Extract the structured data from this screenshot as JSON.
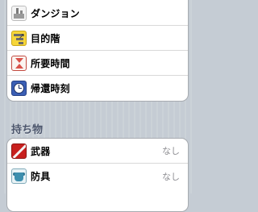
{
  "status": {
    "rows": [
      {
        "label": "ダンジョン",
        "icon": "dungeon-icon"
      },
      {
        "label": "目的階",
        "icon": "stairs-icon"
      },
      {
        "label": "所要時間",
        "icon": "hourglass-icon"
      },
      {
        "label": "帰還時刻",
        "icon": "clock-icon"
      }
    ]
  },
  "inventory": {
    "header": "持ち物",
    "rows": [
      {
        "label": "武器",
        "value": "なし",
        "icon": "sword-icon"
      },
      {
        "label": "防具",
        "value": "なし",
        "icon": "armor-icon"
      }
    ]
  }
}
